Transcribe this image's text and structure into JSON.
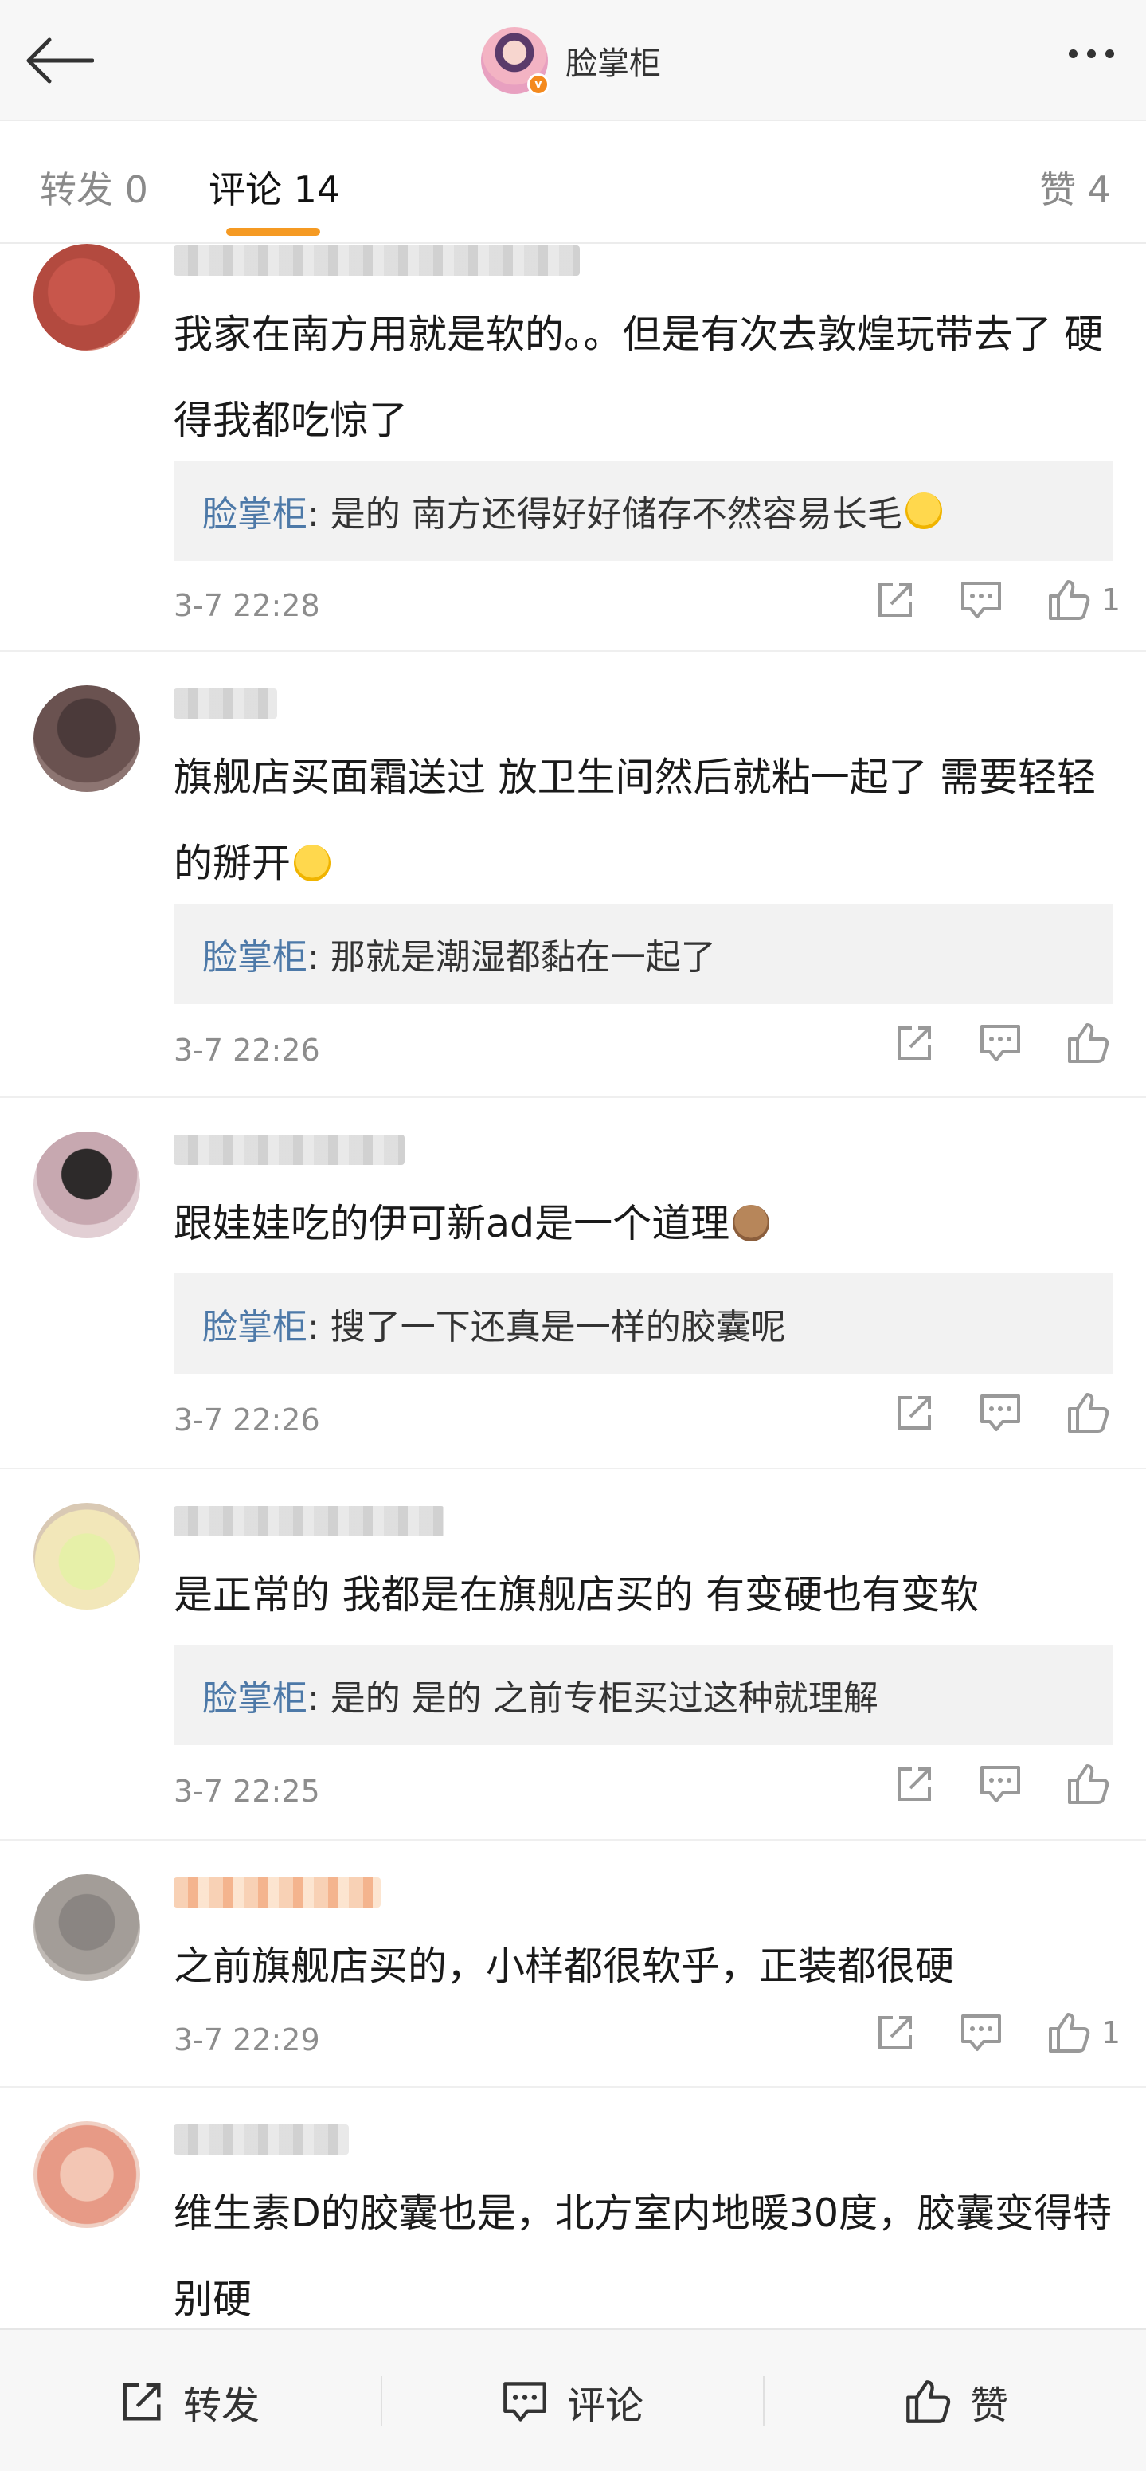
{
  "header": {
    "title": "脸掌柜",
    "back_label": "",
    "verified_mark": "v"
  },
  "tabs": [
    {
      "label": "转发 0"
    },
    {
      "label": "评论 14"
    },
    {
      "label": "赞 4"
    }
  ],
  "comments": [
    {
      "text": "我家在南方用就是软的。。但是有次去敦煌玩带去了 硬得我都吃惊了",
      "reply_author": "脸掌柜",
      "reply_text": ": 是的 南方还得好好储存不然容易长毛",
      "time": "3-7 22:28",
      "likes": "1"
    },
    {
      "text": "旗舰店买面霜送过 放卫生间然后就粘一起了 需要轻轻的掰开",
      "reply_author": "脸掌柜",
      "reply_text": ": 那就是潮湿都黏在一起了",
      "time": "3-7 22:26",
      "likes": ""
    },
    {
      "text": "跟娃娃吃的伊可新ad是一个道理",
      "reply_author": "脸掌柜",
      "reply_text": ": 搜了一下还真是一样的胶囊呢",
      "time": "3-7 22:26",
      "likes": ""
    },
    {
      "text": "是正常的 我都是在旗舰店买的 有变硬也有变软",
      "reply_author": "脸掌柜",
      "reply_text": ": 是的 是的 之前专柜买过这种就理解",
      "time": "3-7 22:25",
      "likes": ""
    },
    {
      "text": "之前旗舰店买的，小样都很软乎，正装都很硬",
      "time": "3-7 22:29",
      "likes": "1"
    },
    {
      "text": "维生素D的胶囊也是，北方室内地暖30度，胶囊变得特别硬"
    }
  ],
  "bottom_bar": {
    "repost": "转发",
    "comment": "评论",
    "like": "赞"
  },
  "colors": {
    "accent": "#f59a23",
    "link": "#4d79a8",
    "muted": "#8d8d8d"
  }
}
